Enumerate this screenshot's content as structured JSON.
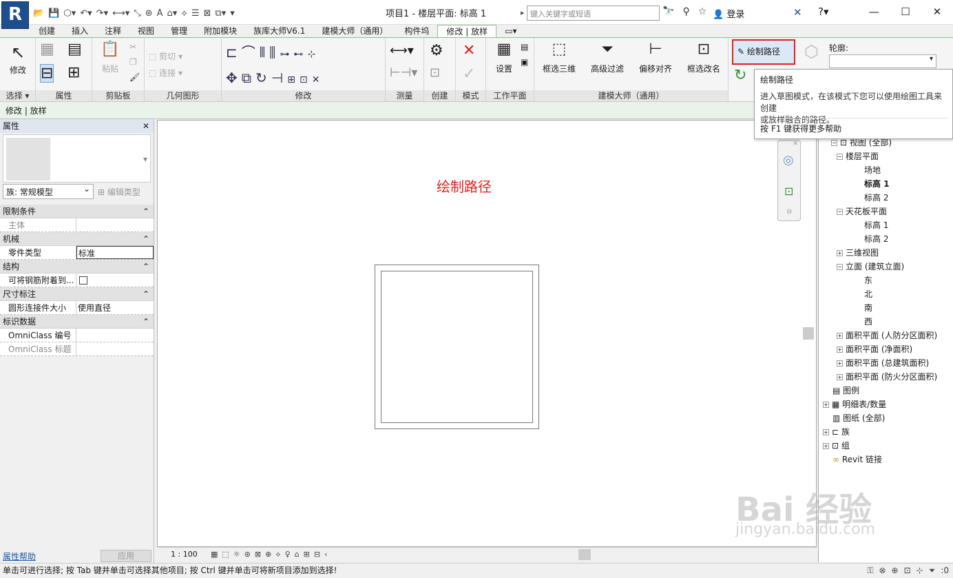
{
  "titlebar": {
    "logo": "R",
    "doc_title": "项目1 - 楼层平面: 标高 1",
    "search_placeholder": "键入关键字或短语",
    "login": "登录"
  },
  "tabs": [
    "创建",
    "插入",
    "注释",
    "视图",
    "管理",
    "附加模块",
    "族库大师V6.1",
    "建模大师（通用）",
    "构件坞",
    "修改 | 放样"
  ],
  "active_tab_index": 9,
  "ribbon": {
    "panels": [
      "选择",
      "属性",
      "剪贴板",
      "几何图形",
      "修改",
      "测量",
      "创建",
      "模式",
      "工作平面",
      "建模大师（通用）"
    ],
    "modify_btn": "修改",
    "paste_btn": "粘贴",
    "cut_btn": "剪切",
    "join_btn": "连接",
    "set_btn": "设置",
    "box_3d_btn": "框选三维",
    "adv_filter_btn": "高级过滤",
    "offset_align_btn": "偏移对齐",
    "box_rename_btn": "框选改名",
    "draw_path_btn": "绘制路径",
    "profile_label": "轮廓:",
    "select_label": "选择 ▾"
  },
  "context_bar": "修改 | 放样",
  "properties": {
    "header": "属性",
    "family_label": "族: 常规模型",
    "edit_type": "编辑类型",
    "sections": [
      {
        "name": "限制条件",
        "rows": [
          {
            "k": "主体",
            "v": "",
            "dim": true
          }
        ]
      },
      {
        "name": "机械",
        "rows": [
          {
            "k": "零件类型",
            "v": "标准"
          }
        ]
      },
      {
        "name": "结构",
        "rows": [
          {
            "k": "可将钢筋附着到...",
            "v": "",
            "checkbox": true
          }
        ]
      },
      {
        "name": "尺寸标注",
        "rows": [
          {
            "k": "圆形连接件大小",
            "v": "使用直径"
          }
        ]
      },
      {
        "name": "标识数据",
        "rows": [
          {
            "k": "OmniClass 编号",
            "v": ""
          },
          {
            "k": "OmniClass 标题",
            "v": "",
            "dim": true
          }
        ]
      }
    ],
    "help_link": "属性帮助",
    "apply_btn": "应用"
  },
  "canvas": {
    "label": "绘制路径",
    "scale": "1 : 100"
  },
  "browser": {
    "header": "视图 (全部)",
    "items": [
      {
        "text": "楼层平面",
        "level": 1,
        "exp": "−"
      },
      {
        "text": "场地",
        "level": 2
      },
      {
        "text": "标高 1",
        "level": 2,
        "bold": true
      },
      {
        "text": "标高 2",
        "level": 2
      },
      {
        "text": "天花板平面",
        "level": 1,
        "exp": "−"
      },
      {
        "text": "标高 1",
        "level": 2
      },
      {
        "text": "标高 2",
        "level": 2
      },
      {
        "text": "三维视图",
        "level": 1,
        "exp": "+"
      },
      {
        "text": "立面 (建筑立面)",
        "level": 1,
        "exp": "−"
      },
      {
        "text": "东",
        "level": 2
      },
      {
        "text": "北",
        "level": 2
      },
      {
        "text": "南",
        "level": 2
      },
      {
        "text": "西",
        "level": 2
      },
      {
        "text": "面积平面 (人防分区面积)",
        "level": 1,
        "exp": "+"
      },
      {
        "text": "面积平面 (净面积)",
        "level": 1,
        "exp": "+"
      },
      {
        "text": "面积平面 (总建筑面积)",
        "level": 1,
        "exp": "+"
      },
      {
        "text": "面积平面 (防火分区面积)",
        "level": 1,
        "exp": "+"
      },
      {
        "text": "图例",
        "level": 0
      },
      {
        "text": "明细表/数量",
        "level": 0,
        "exp": "+"
      },
      {
        "text": "图纸 (全部)",
        "level": 0
      },
      {
        "text": "族",
        "level": 0,
        "exp": "+"
      },
      {
        "text": "组",
        "level": 0,
        "exp": "+"
      },
      {
        "text": "Revit 链接",
        "level": 0
      }
    ]
  },
  "tooltip": {
    "title": "绘制路径",
    "desc1": "进入草图模式，在该模式下您可以使用绘图工具来创建",
    "desc2": "或放样融合的路径。",
    "foot": "按 F1 键获得更多帮助"
  },
  "status": {
    "text": "单击可进行选择; 按 Tab 键并单击可选择其他项目; 按 Ctrl 键并单击可将新项目添加到选择!",
    "filter_count": ":0"
  },
  "watermark": {
    "main": "Bai 经验",
    "sub": "jingyan.baidu.com"
  }
}
